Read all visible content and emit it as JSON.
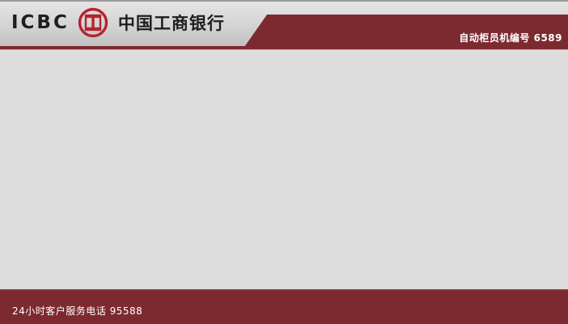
{
  "header": {
    "brand_latin": "ICBC",
    "brand_logo_icon": "icbc-emblem-icon",
    "brand_name": "中国工商银行",
    "atm_number": "自动柜员机编号 6589"
  },
  "footer": {
    "hotline": "24小时客户服务电话 95588"
  },
  "colors": {
    "brand_red": "#7c2a2f",
    "logo_red": "#b5242c",
    "background": "#dcdddc",
    "header_gray": "#cfcfcf"
  }
}
